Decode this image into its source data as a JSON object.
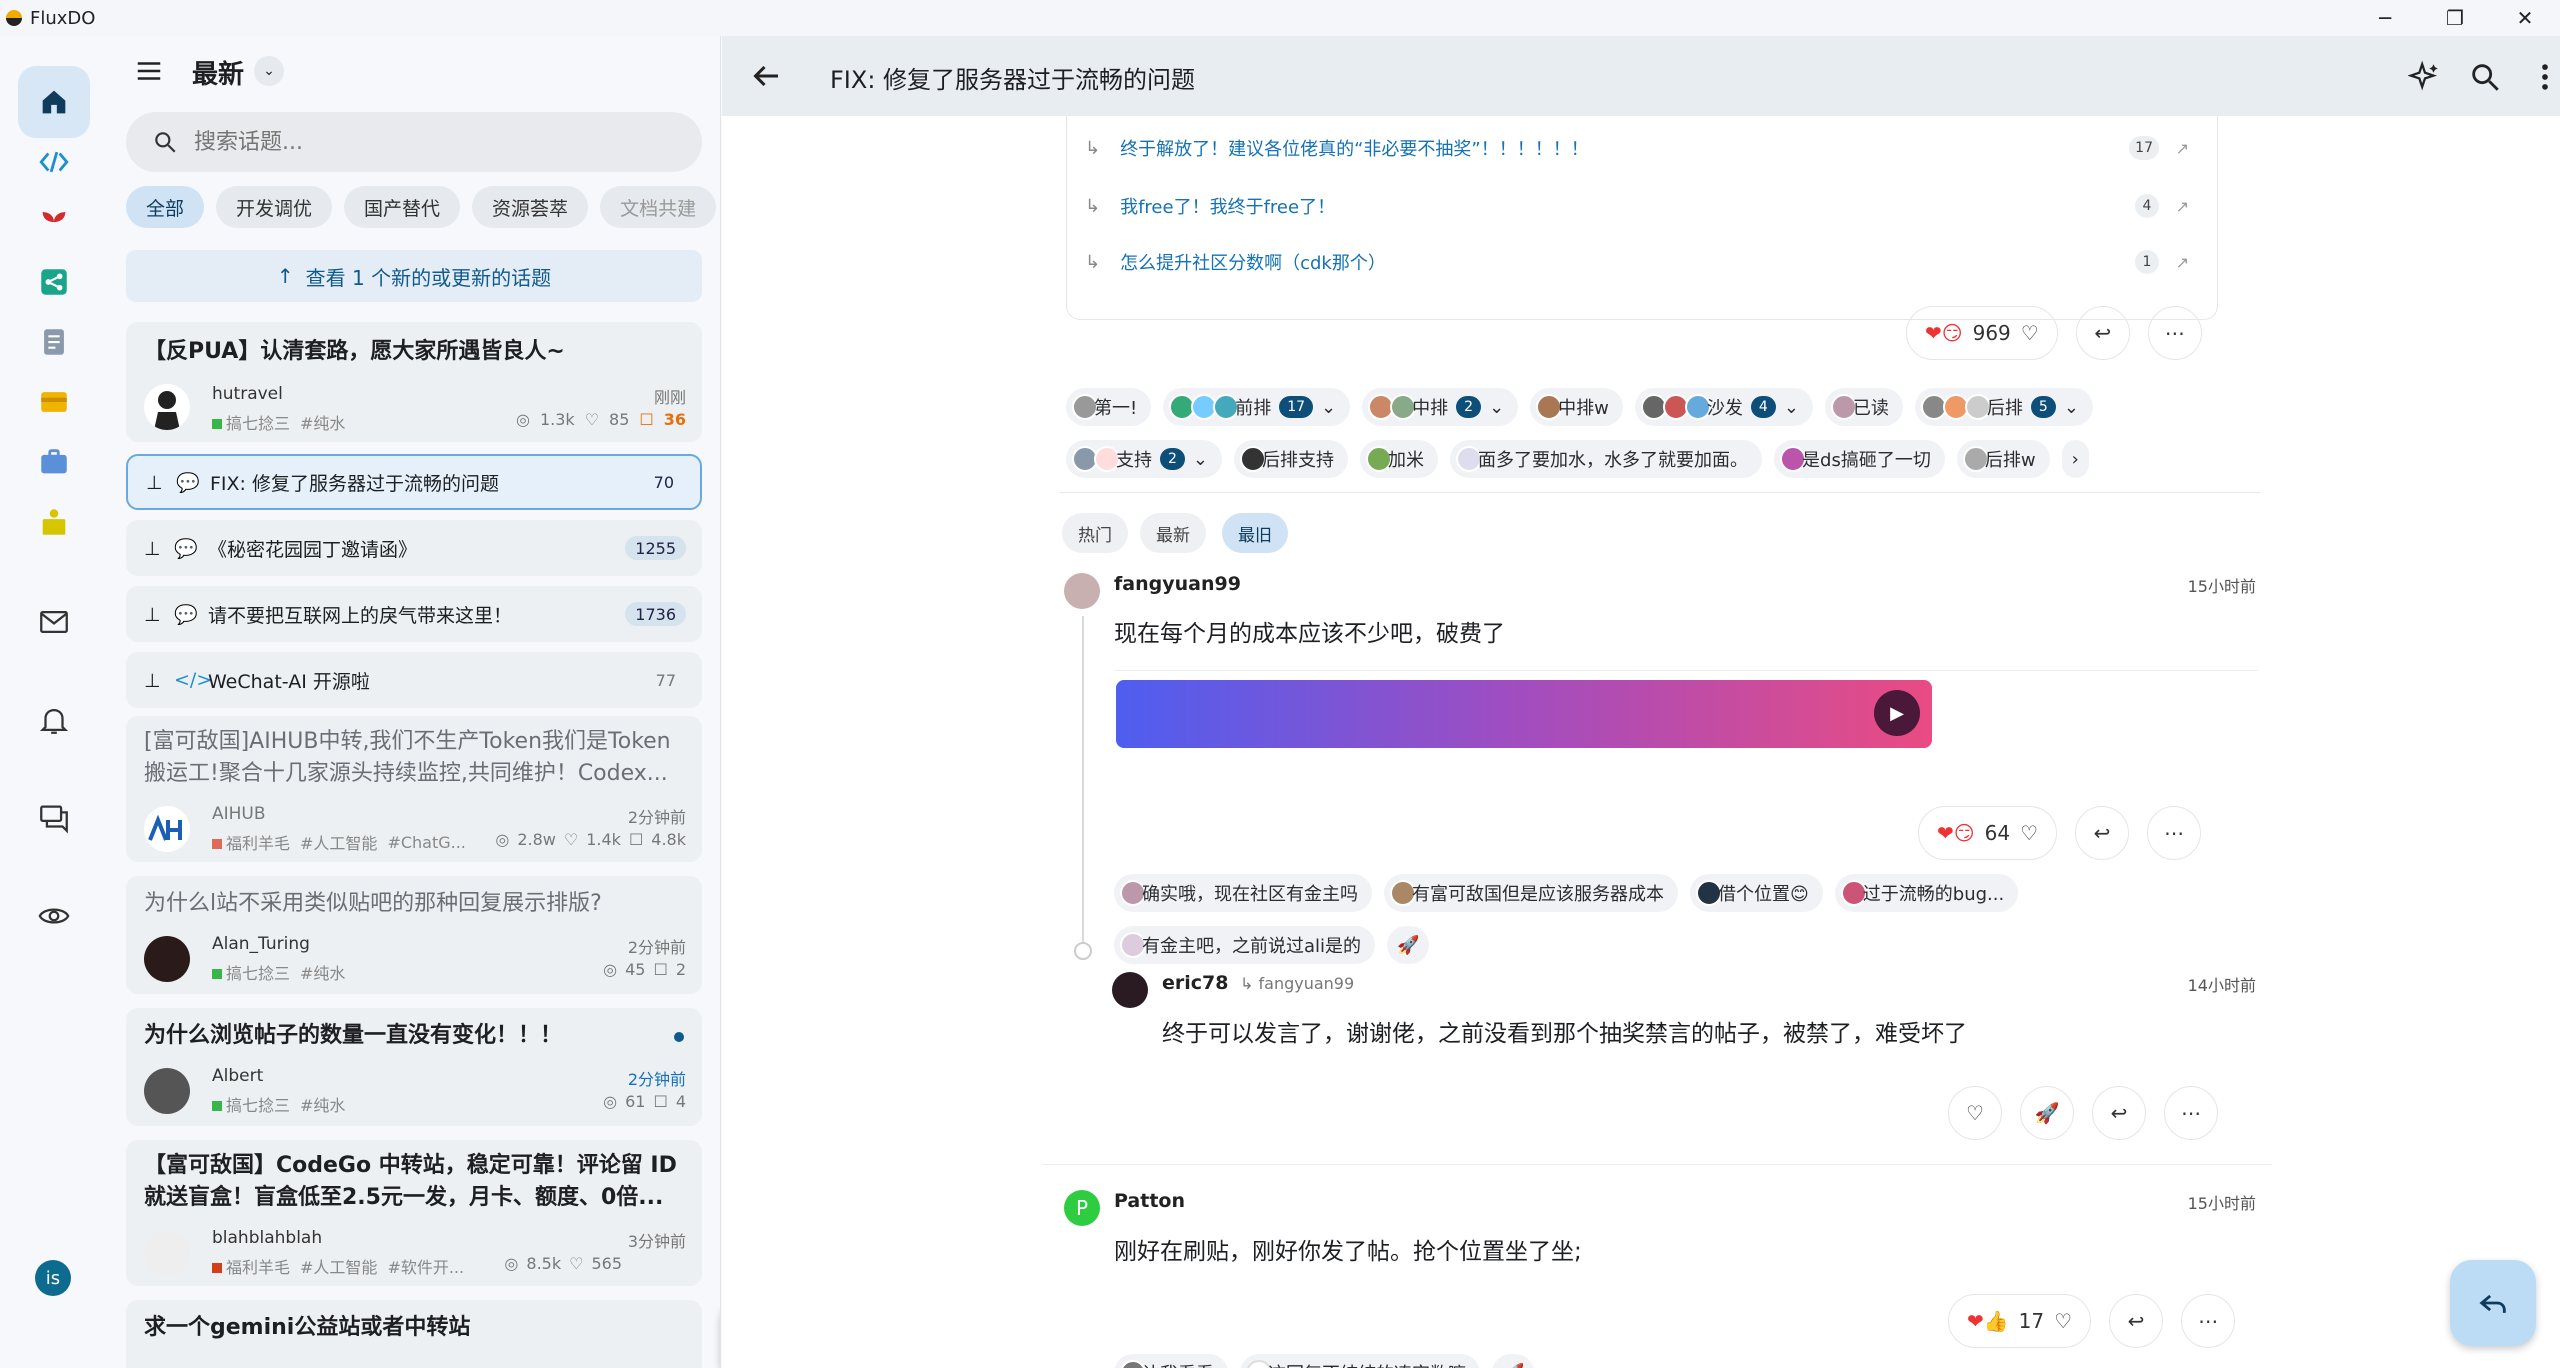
{
  "app": {
    "title": "FluxDO"
  },
  "list": {
    "header_title": "最新",
    "search_placeholder": "搜索话题...",
    "chips": [
      "全部",
      "开发调优",
      "国产替代",
      "资源荟萃",
      "文档共建"
    ],
    "new_topics_banner": "查看 1 个新的或更新的话题",
    "card1": {
      "title": "【反PUA】认清套路，愿大家所遇皆良人~",
      "user": "hutravel",
      "time": "刚刚",
      "category": "搞七捻三",
      "tag": "#纯水",
      "views": "1.3k",
      "likes": "85",
      "replies": "36"
    },
    "pinned": [
      {
        "title": "FIX: 修复了服务器过于流畅的问题",
        "count": "70"
      },
      {
        "title": "《秘密花园园丁邀请函》",
        "count": "1255"
      },
      {
        "title": "请不要把互联网上的戾气带来这里！",
        "count": "1736"
      },
      {
        "title": "WeChat-AI 开源啦",
        "count": "77"
      }
    ],
    "card2": {
      "title": "[富可敌国]AIHUB中转,我们不生产Token我们是Token搬运工!聚合十几家源头持续监控,共同维护！Codex...",
      "user": "AIHUB",
      "time": "2分钟前",
      "category": "福利羊毛",
      "tag1": "#人工智能",
      "tag2": "#ChatG...",
      "views": "2.8w",
      "likes": "1.4k",
      "replies": "4.8k"
    },
    "card3": {
      "title": "为什么l站不采用类似贴吧的那种回复展示排版?",
      "user": "Alan_Turing",
      "time": "2分钟前",
      "category": "搞七捻三",
      "tag": "#纯水",
      "views": "45",
      "replies": "2"
    },
    "card4": {
      "title": "为什么浏览帖子的数量一直没有变化！！！",
      "user": "Albert",
      "time": "2分钟前",
      "category": "搞七捻三",
      "tag": "#纯水",
      "views": "61",
      "replies": "4"
    },
    "card5": {
      "title": "【富可敌国】CodeGo 中转站，稳定可靠！评论留 ID 就送盲盒！盲盒低至2.5元一发，月卡、额度、0倍...",
      "user": "blahblahblah",
      "time": "3分钟前",
      "category": "福利羊毛",
      "tag1": "#人工智能",
      "tag2": "#软件开...",
      "views": "8.5k",
      "likes": "565"
    },
    "card6": {
      "title": "求一个gemini公益站或者中转站"
    },
    "fab": "+"
  },
  "detail": {
    "title": "FIX: 修复了服务器过于流畅的问题",
    "linked_topics": [
      {
        "title": "终于解放了！建议各位佬真的“非必要不抽奖”！！！！！！",
        "count": "17"
      },
      {
        "title": "我free了！我终于free了！",
        "count": "4"
      },
      {
        "title": "怎么提升社区分数啊（cdk那个）",
        "count": "1"
      }
    ],
    "main_reactions": "969",
    "vote_chips": [
      {
        "label": "第一!"
      },
      {
        "label": "前排",
        "count": "17"
      },
      {
        "label": "中排",
        "count": "2"
      },
      {
        "label": "中排w"
      },
      {
        "label": "沙发",
        "count": "4"
      },
      {
        "label": "已读"
      },
      {
        "label": "后排",
        "count": "5"
      },
      {
        "label": "支持",
        "count": "2"
      },
      {
        "label": "后排支持"
      },
      {
        "label": "加米"
      },
      {
        "label": "面多了要加水，水多了就要加面。"
      },
      {
        "label": "是ds搞砸了一切"
      },
      {
        "label": "后排w"
      }
    ],
    "sort_tabs": [
      "热门",
      "最新",
      "最旧"
    ],
    "post1": {
      "user": "fangyuan99",
      "time": "15小时前",
      "text": "现在每个月的成本应该不少吧，破费了",
      "reactions": "64",
      "quick_replies": [
        "确实哦，现在社区有金主吗",
        "有富可敌国但是应该服务器成本",
        "借个位置😊",
        "过于流畅的bug...",
        "有金主吧，之前说过ali是的"
      ]
    },
    "reply1": {
      "user": "eric78",
      "reply_to": "fangyuan99",
      "time": "14小时前",
      "text": "终于可以发言了，谢谢佬，之前没看到那个抽奖禁言的帖子，被禁了，难受坏了"
    },
    "post2": {
      "user": "Patton",
      "avatar_letter": "P",
      "time": "15小时前",
      "text": "刚好在刷贴，刚好你发了帖。抢个位置坐了坐;",
      "reactions": "17",
      "quick_replies": [
        "让我看看",
        "这回复不纯纯的凑字数嘛"
      ]
    }
  },
  "user_avatar": "is"
}
